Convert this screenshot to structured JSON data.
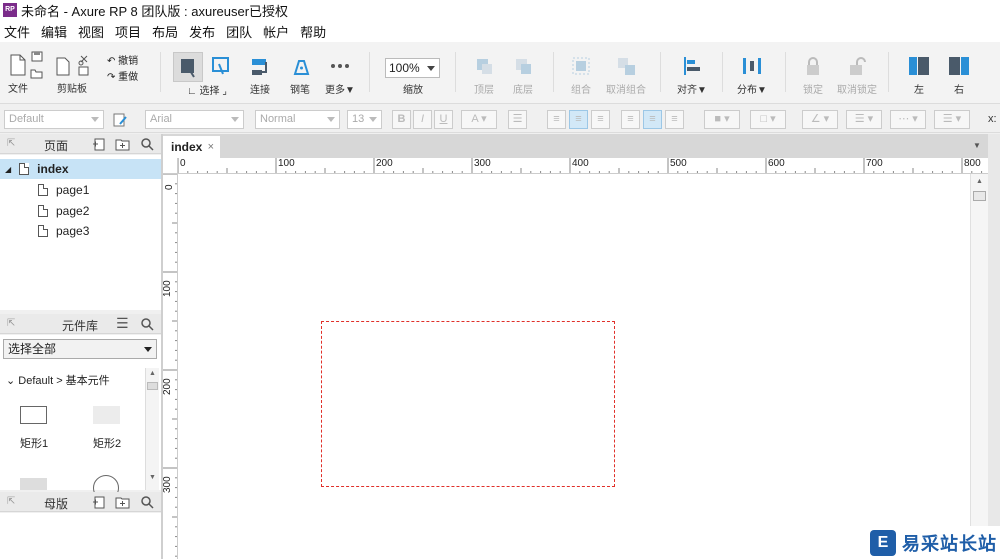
{
  "window": {
    "title": "未命名 - Axure RP 8 团队版 : axureuser已授权",
    "app_icon_text": "RP"
  },
  "menu": [
    "文件",
    "编辑",
    "视图",
    "项目",
    "布局",
    "发布",
    "团队",
    "帐户",
    "帮助"
  ],
  "toolbar": {
    "file": "文件",
    "clipboard": "剪贴板",
    "undo": "撤销",
    "redo": "重做",
    "select": "选择",
    "connect": "连接",
    "pen": "钢笔",
    "more": "更多▼",
    "zoom_value": "100%",
    "zoom": "缩放",
    "top_layer": "顶层",
    "bottom_layer": "底层",
    "group": "组合",
    "ungroup": "取消组合",
    "align": "对齐▼",
    "distribute": "分布▼",
    "lock": "锁定",
    "unlock": "取消锁定",
    "left": "左",
    "right": "右"
  },
  "format": {
    "style": "Default",
    "font": "Arial",
    "weight": "Normal",
    "size": "13",
    "bold": "B",
    "italic": "I",
    "underline": "U",
    "coord_label": "x:"
  },
  "pages_panel": {
    "title": "页面",
    "pages": [
      {
        "label": "index",
        "selected": true,
        "level": 0
      },
      {
        "label": "page1",
        "selected": false,
        "level": 1
      },
      {
        "label": "page2",
        "selected": false,
        "level": 1
      },
      {
        "label": "page3",
        "selected": false,
        "level": 1
      }
    ]
  },
  "library_panel": {
    "title": "元件库",
    "dropdown": "选择全部",
    "group": "Default > 基本元件",
    "widgets": [
      "矩形1",
      "矩形2"
    ]
  },
  "masters_panel": {
    "title": "母版"
  },
  "editor": {
    "tab": "index",
    "tab_close": "×",
    "hruler_labels": [
      "0",
      "100",
      "200",
      "300",
      "400",
      "500",
      "600",
      "700",
      "800"
    ],
    "vruler_labels": [
      "0",
      "100",
      "200",
      "300"
    ]
  },
  "watermark": {
    "text": "易采站长站",
    "logo": "E"
  },
  "colors": {
    "selection": "#e0302a",
    "accent": "#2a8fd6",
    "selected_row": "#c7e3f6"
  }
}
